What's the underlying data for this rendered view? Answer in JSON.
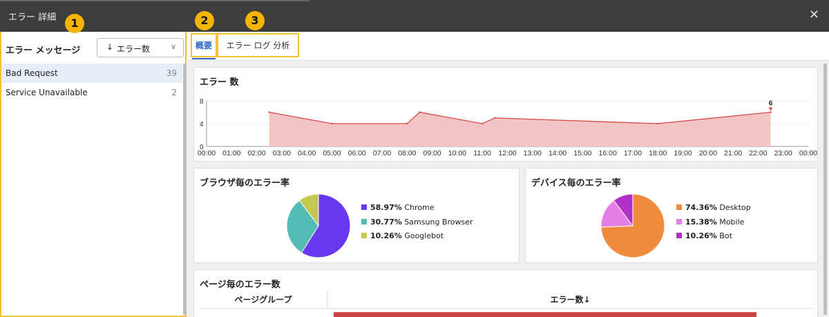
{
  "window": {
    "title": "エラー 詳細",
    "close_glyph": "✕"
  },
  "badges": [
    "1",
    "2",
    "3"
  ],
  "left_panel": {
    "header": "エラー メッセージ",
    "sort": {
      "arrow": "↓",
      "label": "エラー数",
      "chevron": "∨"
    },
    "errors": [
      {
        "name": "Bad Request",
        "count": "39"
      },
      {
        "name": "Service Unavailable",
        "count": "2"
      }
    ]
  },
  "tabs": [
    {
      "label": "概要"
    },
    {
      "label": "エラー ログ 分析"
    }
  ],
  "error_count_card": {
    "title": "エラー 数",
    "peak_label": "6"
  },
  "browser_card": {
    "title": "ブラウザ毎のエラー率"
  },
  "device_card": {
    "title": "デバイス毎のエラー率"
  },
  "page_card": {
    "title": "ページ毎のエラー数",
    "columns": [
      "ページグループ",
      "エラー数↓"
    ]
  },
  "colors": {
    "accent": "#2a64c8",
    "badge": "#f4b400",
    "highlight_border": "#f2c230",
    "line": "#d94848",
    "area": "#f3c4c4",
    "page_bar": "#cc4444"
  },
  "chart_data": [
    {
      "type": "area",
      "title": "エラー 数",
      "x": [
        "00:00",
        "01:00",
        "02:00",
        "03:00",
        "04:00",
        "05:00",
        "06:00",
        "07:00",
        "08:00",
        "09:00",
        "10:00",
        "11:00",
        "12:00",
        "13:00",
        "14:00",
        "15:00",
        "16:00",
        "17:00",
        "18:00",
        "19:00",
        "20:00",
        "21:00",
        "22:00",
        "23:00",
        "00:00"
      ],
      "points": [
        {
          "x": 2.5,
          "y": 6
        },
        {
          "x": 5.0,
          "y": 4
        },
        {
          "x": 8.0,
          "y": 4
        },
        {
          "x": 8.5,
          "y": 6
        },
        {
          "x": 11.0,
          "y": 4
        },
        {
          "x": 11.5,
          "y": 5
        },
        {
          "x": 18.0,
          "y": 4
        },
        {
          "x": 22.5,
          "y": 6
        }
      ],
      "yticks": [
        0,
        4,
        8
      ],
      "ylim": [
        0,
        8
      ],
      "xlim": [
        0,
        24
      ],
      "annotation": {
        "x": 22.5,
        "y": 6,
        "label": "6"
      }
    },
    {
      "type": "pie",
      "title": "ブラウザ毎のエラー率",
      "slices": [
        {
          "name": "Chrome",
          "percent": "58.97%",
          "value": 58.97,
          "color": "#6a38f0"
        },
        {
          "name": "Samsung Browser",
          "percent": "30.77%",
          "value": 30.77,
          "color": "#52bcb6"
        },
        {
          "name": "Googlebot",
          "percent": "10.26%",
          "value": 10.26,
          "color": "#c4c84e"
        }
      ]
    },
    {
      "type": "pie",
      "title": "デバイス毎のエラー率",
      "slices": [
        {
          "name": "Desktop",
          "percent": "74.36%",
          "value": 74.36,
          "color": "#f08a3c"
        },
        {
          "name": "Mobile",
          "percent": "15.38%",
          "value": 15.38,
          "color": "#e67ee6"
        },
        {
          "name": "Bot",
          "percent": "10.26%",
          "value": 10.26,
          "color": "#b030c8"
        }
      ]
    }
  ]
}
